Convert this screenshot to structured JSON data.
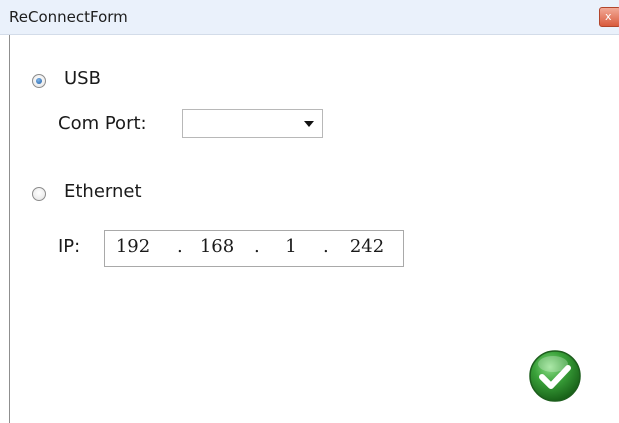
{
  "window": {
    "title": "ReConnectForm",
    "close_glyph": "x"
  },
  "usb": {
    "label": "USB",
    "selected": true,
    "com_port_label": "Com Port:",
    "com_port_value": ""
  },
  "ethernet": {
    "label": "Ethernet",
    "selected": false,
    "ip_label": "IP:",
    "ip": [
      "192",
      "168",
      "1",
      "242"
    ],
    "separator": "."
  },
  "ok_button": {
    "icon": "checkmark-icon",
    "color": "#2e8b2e"
  },
  "colors": {
    "titlebar_bg": "#eaf1fb",
    "radio_accent": "#1f5fa6",
    "close_red": "#d95b3d"
  }
}
